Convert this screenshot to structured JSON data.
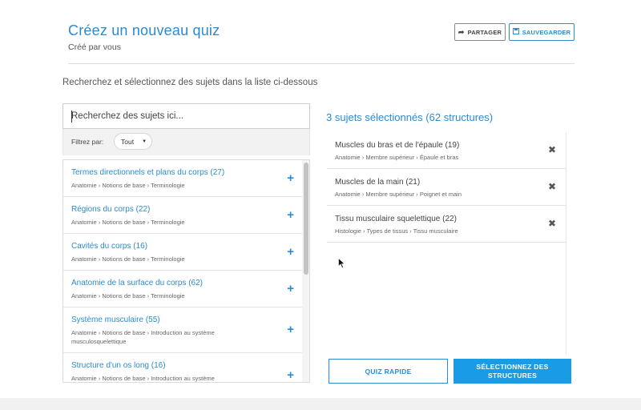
{
  "header": {
    "title": "Créez un nouveau quiz",
    "subtitle": "Créé par vous",
    "share_label": "PARTAGER",
    "save_label": "SAUVEGARDER",
    "share_icon": "share-arrow-icon",
    "save_icon": "floppy-disk-icon"
  },
  "instructions": "Recherchez et sélectionnez des sujets dans la liste ci-dessous",
  "search": {
    "placeholder": "Recherchez des sujets ici...",
    "value": ""
  },
  "filter": {
    "label": "Filtrez par:",
    "selected": "Tout"
  },
  "topics": [
    {
      "title": "Termes directionnels et plans du corps (27)",
      "path": "Anatomie › Notions de base › Terminologie"
    },
    {
      "title": "Régions du corps (22)",
      "path": "Anatomie › Notions de base › Terminologie"
    },
    {
      "title": "Cavités du corps (16)",
      "path": "Anatomie › Notions de base › Terminologie"
    },
    {
      "title": "Anatomie de la surface du corps (62)",
      "path": "Anatomie › Notions de base › Terminologie"
    },
    {
      "title": "Système musculaire (55)",
      "path": "Anatomie › Notions de base › Introduction au système musculosquelettique"
    },
    {
      "title": "Structure d'un os long (16)",
      "path": "Anatomie › Notions de base › Introduction au système"
    }
  ],
  "selected": {
    "summary": "3 sujets sélectionnés (62 structures)",
    "items": [
      {
        "title": "Muscles du bras et de l'épaule (19)",
        "path": "Anatomie › Membre supérieur › Épaule et bras"
      },
      {
        "title": "Muscles de la main (21)",
        "path": "Anatomie › Membre supérieur › Poignet et main"
      },
      {
        "title": "Tissu musculaire squelettique (22)",
        "path": "Histologie › Types de tissus › Tissu musculaire"
      }
    ]
  },
  "actions": {
    "quick_quiz": "QUIZ RAPIDE",
    "select_structures": "SÉLECTIONNEZ DES STRUCTURES"
  },
  "colors": {
    "accent": "#2b8bd0",
    "primary_button": "#1a9be6"
  }
}
